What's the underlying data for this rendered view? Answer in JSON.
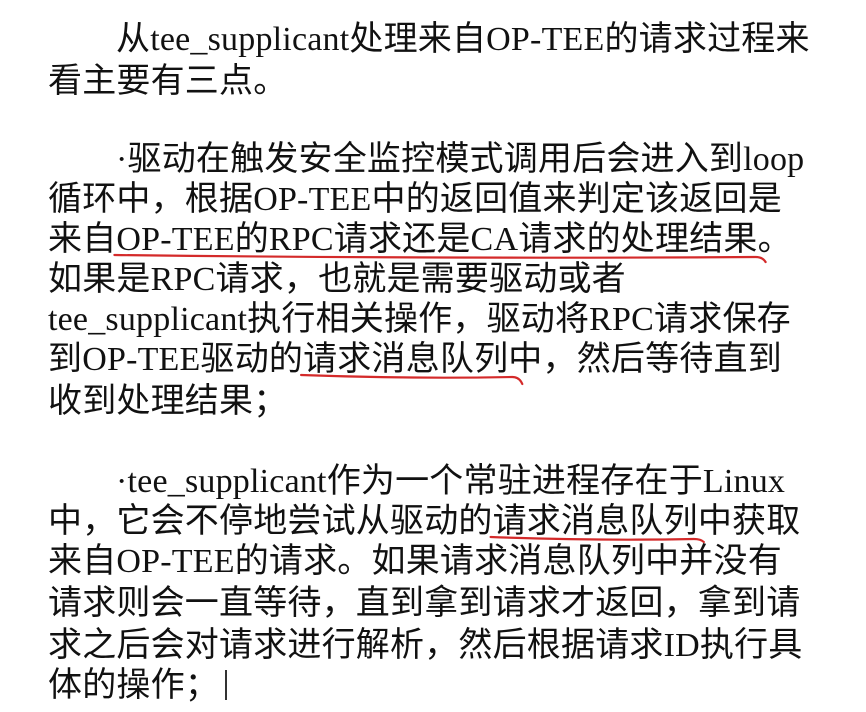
{
  "paragraphs": [
    {
      "lines": [
        "从tee_supplicant处理来自OP-TEE的请求过程来",
        "看主要有三点。"
      ]
    },
    {
      "lines": [
        "·驱动在触发安全监控模式调用后会进入到loop",
        "循环中，根据OP-TEE中的返回值来判定该返回是",
        {
          "before": "来自",
          "highlight": "OP-TEE的RPC请求还是CA请求的处理结果",
          "after": "。"
        },
        "如果是RPC请求，也就是需要驱动或者",
        "tee_supplicant执行相关操作，驱动将RPC请求保存",
        {
          "before": "到OP-TEE驱动的",
          "highlight": "请求消息队列",
          "after": "中，然后等待直到"
        },
        "收到处理结果；"
      ]
    },
    {
      "lines": [
        "·tee_supplicant作为一个常驻进程存在于Linux",
        {
          "before": "中，它会不停地尝试从驱动的",
          "highlight": "请求消息队列",
          "after": "中获取"
        },
        "来自OP-TEE的请求。如果请求消息队列中并没有",
        "请求则会一直等待，直到拿到请求才返回，拿到请",
        "求之后会对请求进行解析，然后根据请求ID执行具",
        "体的操作；"
      ]
    }
  ],
  "underline_color": "#d42a2a"
}
